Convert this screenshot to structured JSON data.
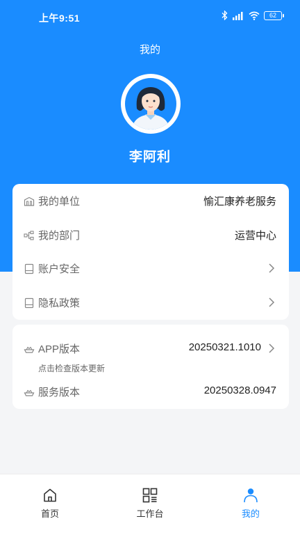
{
  "status_bar": {
    "time": "上午9:51",
    "battery": "62"
  },
  "header": {
    "title": "我的",
    "user_name": "李阿利"
  },
  "info_card": {
    "rows": [
      {
        "label": "我的单位",
        "value": "愉汇康养老服务",
        "icon": "building-icon"
      },
      {
        "label": "我的部门",
        "value": "运营中心",
        "icon": "org-chart-icon"
      },
      {
        "label": "账户安全",
        "value": "",
        "icon": "tablet-icon"
      },
      {
        "label": "隐私政策",
        "value": "",
        "icon": "tablet-icon"
      }
    ]
  },
  "version_card": {
    "app": {
      "label": "APP版本",
      "value": "20250321.1010",
      "hint": "点击检查版本更新",
      "icon": "ship-icon"
    },
    "service": {
      "label": "服务版本",
      "value": "20250328.0947",
      "icon": "ship-icon"
    }
  },
  "tab_bar": {
    "tabs": [
      {
        "label": "首页",
        "icon": "home-icon"
      },
      {
        "label": "工作台",
        "icon": "grid-icon"
      },
      {
        "label": "我的",
        "icon": "person-icon"
      }
    ],
    "active_color": "#1a8cff"
  },
  "colors": {
    "primary": "#1a8cff",
    "background": "#f4f5f7"
  }
}
